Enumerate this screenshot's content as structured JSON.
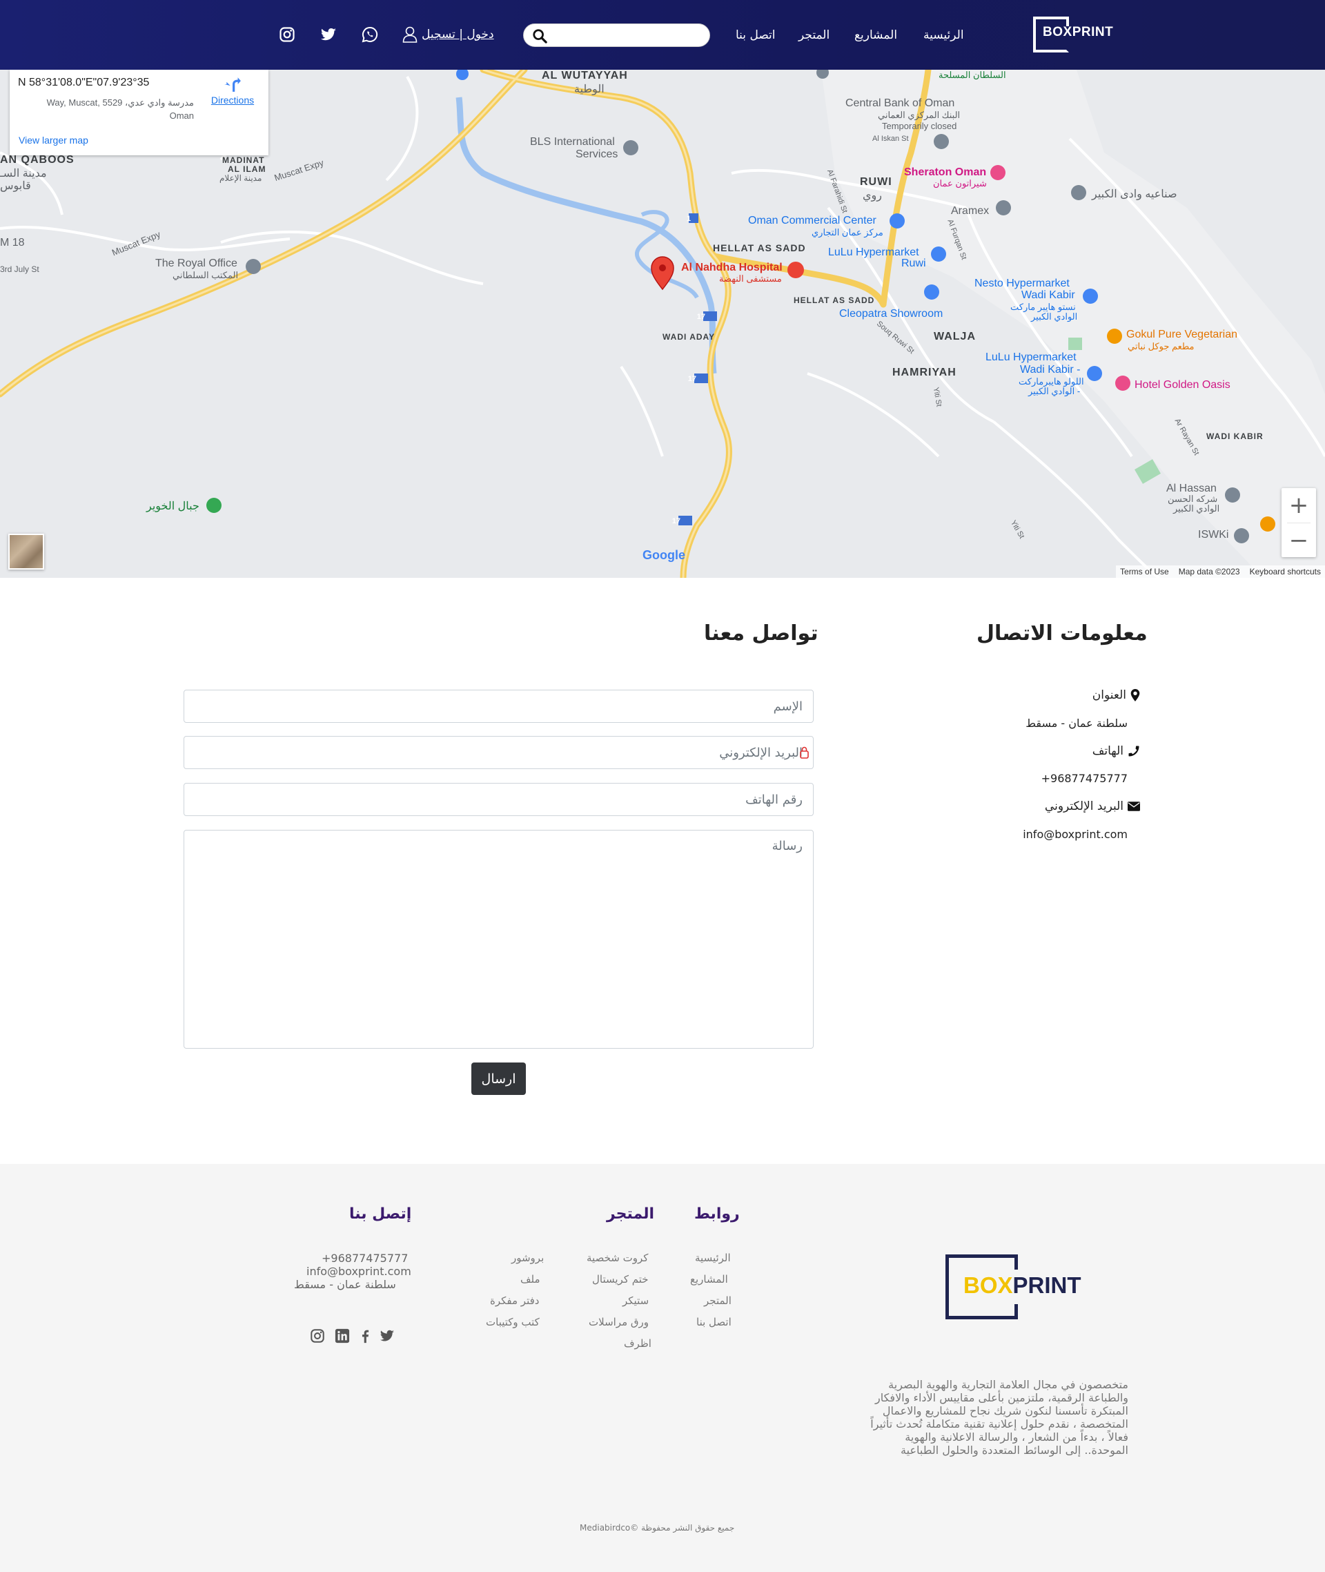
{
  "header": {
    "logo": {
      "box": "BOX",
      "print": "PRINT"
    },
    "nav": {
      "home": "الرئيسية",
      "projects": "المشاريع",
      "store": "المتجر",
      "contact": "اتصل بنا"
    },
    "search": {
      "placeholder": ""
    },
    "login_label": "دخول | تسجيل"
  },
  "map": {
    "coordinates": "23°35'07.9\"N 58°31'08.0\"E",
    "address_line1": "مدرسة وادي عدي، Way, Muscat, 5529",
    "address_line2": "Oman",
    "directions_label": "Directions",
    "larger_map_label": "View larger map",
    "labels": {
      "wutayyah": "AL WUTAYYAH",
      "wutayyah_ar": "الوطية",
      "bls": "BLS International",
      "bls2": "Services",
      "central_bank": "Central Bank of Oman",
      "central_bank_ar": "البنك المركزي العماني",
      "central_bank_status": "Temporarily closed",
      "sheraton": "Sheraton Oman",
      "sheraton_ar": "شيراتون عمان",
      "ruwi": "RUWI",
      "ruwi_ar": "روي",
      "aramex": "Aramex",
      "wadi_kabir_industrial": "صناعيه وادى الكبير",
      "omc": "Oman Commercial Center",
      "omc_ar": "مركز عمان التجاري",
      "hellat": "HELLAT AS SADD",
      "lulu_ruwi": "LuLu Hypermarket",
      "lulu_ruwi2": "Ruwi",
      "nahdha": "Al Nahdha Hospital",
      "nahdha_ar": "مستشفى النهضة",
      "nesto": "Nesto Hypermarket",
      "nesto2": "Wadi Kabir",
      "nesto_ar": "نستو هايبر ماركت",
      "nesto_ar2": "الوادي الكبير",
      "gokul": "Gokul Pure Vegetarian",
      "gokul_ar": "مطعم جوكل نباتي",
      "hellat2": "HELLAT AS SADD",
      "cleopatra": "Cleopatra Showroom",
      "walja": "WALJA",
      "wadi_aday": "WADI ADAY",
      "lulu_wk": "LuLu Hypermarket",
      "lulu_wk2": "- Wadi Kabir",
      "lulu_wk_ar": "اللولو هايبرماركت",
      "lulu_wk_ar2": "- الوادي الكبير",
      "golden_oasis": "Hotel Golden Oasis",
      "hamriyah": "HAMRIYAH",
      "wadi_kabir": "WADI KABIR",
      "royal_office": "The Royal Office",
      "royal_office_ar": "المكتب السلطاني",
      "muscat_expy": "Muscat Expy",
      "muscat_expy2": "Muscat Expy",
      "madinat": "MADINAT",
      "al_ilam": "AL ILAM",
      "madinat_ar": "مدينة الإعلام",
      "qaboos": "AN QABOOS",
      "qaboos_ar": "مدينة السـ",
      "qaboos_ar2": "قابوس",
      "m18": "M 18",
      "july": "3rd July St",
      "huwair": "جبال الخوير",
      "hassan": "Al Hassan",
      "hassan_ar": "شركه الحسن",
      "hassan_ar2": "الوادي الكبير",
      "iswki": "ISWKi",
      "sultan": "السلطان المسلحة",
      "farahidi": "Al Farahidi St",
      "furqan": "Al Furqan St",
      "iskan": "Al Iskan St",
      "souq_ruwi": "Souq Ruwi St",
      "ar_rayan": "Ar Rayan St",
      "yiti": "Yiti St",
      "yiti2": "Yiti St",
      "road17": "17",
      "road17b": "17",
      "road17c": "17",
      "road1": "1"
    },
    "google_label": "Google",
    "footer": {
      "shortcuts": "Keyboard shortcuts",
      "data": "Map data ©2023",
      "terms": "Terms of Use"
    },
    "zoom_in": "+",
    "zoom_out": "−"
  },
  "contact_info": {
    "title": "معلومات الاتصال",
    "address_label": "العنوان",
    "address_value": "سلطنة عمان - مسقط",
    "phone_label": "الهاتف",
    "phone_value": "96877475777+",
    "email_label": "البريد الإلكتروني",
    "email_value": "info@boxprint.com"
  },
  "contact_form": {
    "title": "تواصل معنا",
    "name_placeholder": "الإسم",
    "email_placeholder": "البريد الإلكتروني",
    "phone_placeholder": "رقم الهاتف",
    "message_placeholder": "رسالة",
    "submit_label": "ارسال"
  },
  "footer": {
    "logo": {
      "box": "BOX",
      "print": "PRINT"
    },
    "about": "متخصصون في مجال العلامة التجارية والهوية البصرية والطباعة الرقمية، ملتزمين بأعلى مقاييس الأداء والافكار المبتكرة تأسسنا لنكون شريك نجاح للمشاريع والاعمال المتخصصة ، نقدم حلول إعلانية تقنية متكاملة تُحدث تأثيراً فعالاً ، بدءاً من الشعار ، والرسالة الاعلانية والهوية الموحدة.. إلى الوسائط المتعددة والحلول الطباعية",
    "links_title": "روابط",
    "links": [
      "الرئيسية",
      "المشاريع",
      "المتجر",
      "اتصل بنا"
    ],
    "store_title": "المتجر",
    "store_col1": [
      "كروت شخصية",
      "ختم كريستال",
      "ستيكر",
      "ورق مراسلات",
      "اظرف"
    ],
    "store_col2": [
      "بروشور",
      "ملف",
      "دفتر مفكرة",
      "كتب وكتيبات"
    ],
    "contact_title": "إتصل بنا",
    "contact_phone": "96877475777+",
    "contact_email": "info@boxprint.com",
    "contact_address": "سلطنة عمان - مسقط",
    "copyright": "جميع حقوق النشر محفوظة ©Mediabirdco"
  },
  "colors": {
    "header_bg": "#1a2070",
    "footer_heading": "#3b1a6d",
    "logo_accent": "#f2c200",
    "button_dark": "#33363a"
  }
}
